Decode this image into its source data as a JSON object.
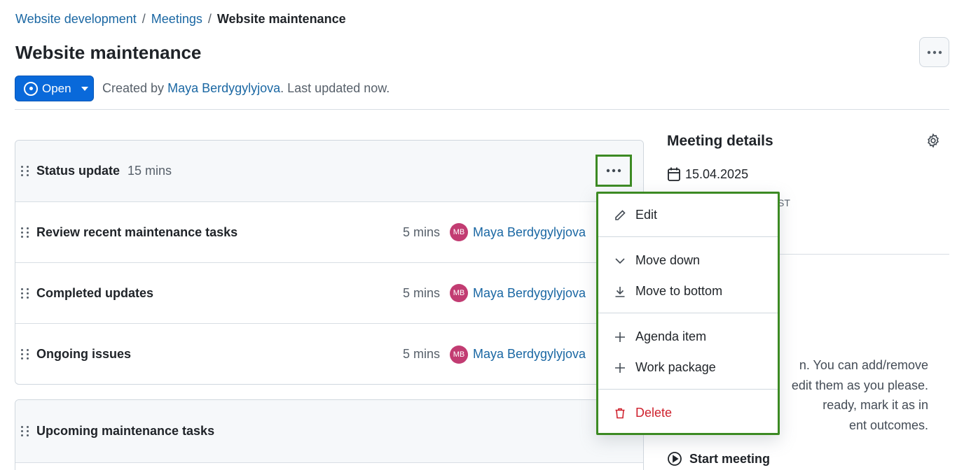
{
  "breadcrumb": {
    "project": "Website development",
    "module": "Meetings",
    "current": "Website maintenance"
  },
  "page": {
    "title": "Website maintenance"
  },
  "status": {
    "label": "Open",
    "created_prefix": "Created by",
    "author": "Maya Berdygylyjova",
    "updated": ". Last updated now."
  },
  "section1": {
    "title": "Status update",
    "duration": "15 mins",
    "items": [
      {
        "title": "Review recent maintenance tasks",
        "duration": "5 mins",
        "initials": "MB",
        "user": "Maya Berdygylyjova"
      },
      {
        "title": "Completed updates",
        "duration": "5 mins",
        "initials": "MB",
        "user": "Maya Berdygylyjova"
      },
      {
        "title": "Ongoing issues",
        "duration": "5 mins",
        "initials": "MB",
        "user": "Maya Berdygylyjova"
      }
    ]
  },
  "section2": {
    "title": "Upcoming maintenance tasks"
  },
  "sidebar": {
    "details_title": "Meeting details",
    "date": "15.04.2025",
    "tz_fragment": "ST",
    "help_lines": [
      "n. You can add/remove",
      "edit them as you please.",
      "ready, mark it as in",
      "ent outcomes."
    ],
    "start_meeting": "Start meeting"
  },
  "menu": {
    "edit": "Edit",
    "move_down": "Move down",
    "move_to_bottom": "Move to bottom",
    "agenda_item": "Agenda item",
    "work_package": "Work package",
    "delete": "Delete"
  },
  "colors": {
    "accent": "#0969da",
    "link": "#1a67a3",
    "avatar": "#c23c72",
    "danger": "#cf222e",
    "highlight": "#3c8a23"
  }
}
